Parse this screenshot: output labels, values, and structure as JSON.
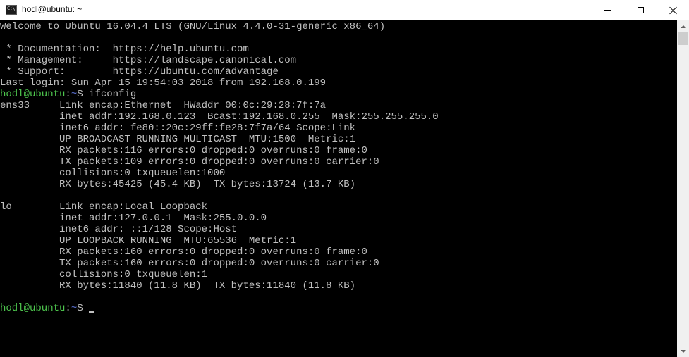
{
  "window": {
    "title": "hodl@ubuntu: ~",
    "icon": "console-icon",
    "icon_glyph": "C:\\",
    "buttons": {
      "minimize": "minimize-icon",
      "maximize": "maximize-icon",
      "close": "close-icon"
    }
  },
  "terminal": {
    "colors": {
      "background": "#000000",
      "text": "#c0c0c0",
      "prompt_user": "#4dc44d",
      "prompt_path": "#5c73d6"
    },
    "lines": [
      "Welcome to Ubuntu 16.04.4 LTS (GNU/Linux 4.4.0-31-generic x86_64)",
      "",
      " * Documentation:  https://help.ubuntu.com",
      " * Management:     https://landscape.canonical.com",
      " * Support:        https://ubuntu.com/advantage",
      "Last login: Sun Apr 15 19:54:03 2018 from 192.168.0.199"
    ],
    "prompt1": {
      "user": "hodl@ubuntu",
      "sep": ":",
      "path": "~",
      "symbol": "$ ",
      "command": "ifconfig"
    },
    "output": [
      "ens33     Link encap:Ethernet  HWaddr 00:0c:29:28:7f:7a",
      "          inet addr:192.168.0.123  Bcast:192.168.0.255  Mask:255.255.255.0",
      "          inet6 addr: fe80::20c:29ff:fe28:7f7a/64 Scope:Link",
      "          UP BROADCAST RUNNING MULTICAST  MTU:1500  Metric:1",
      "          RX packets:116 errors:0 dropped:0 overruns:0 frame:0",
      "          TX packets:109 errors:0 dropped:0 overruns:0 carrier:0",
      "          collisions:0 txqueuelen:1000",
      "          RX bytes:45425 (45.4 KB)  TX bytes:13724 (13.7 KB)",
      "",
      "lo        Link encap:Local Loopback",
      "          inet addr:127.0.0.1  Mask:255.0.0.0",
      "          inet6 addr: ::1/128 Scope:Host",
      "          UP LOOPBACK RUNNING  MTU:65536  Metric:1",
      "          RX packets:160 errors:0 dropped:0 overruns:0 frame:0",
      "          TX packets:160 errors:0 dropped:0 overruns:0 carrier:0",
      "          collisions:0 txqueuelen:1",
      "          RX bytes:11840 (11.8 KB)  TX bytes:11840 (11.8 KB)",
      ""
    ],
    "prompt2": {
      "user": "hodl@ubuntu",
      "sep": ":",
      "path": "~",
      "symbol": "$ ",
      "command": ""
    }
  }
}
